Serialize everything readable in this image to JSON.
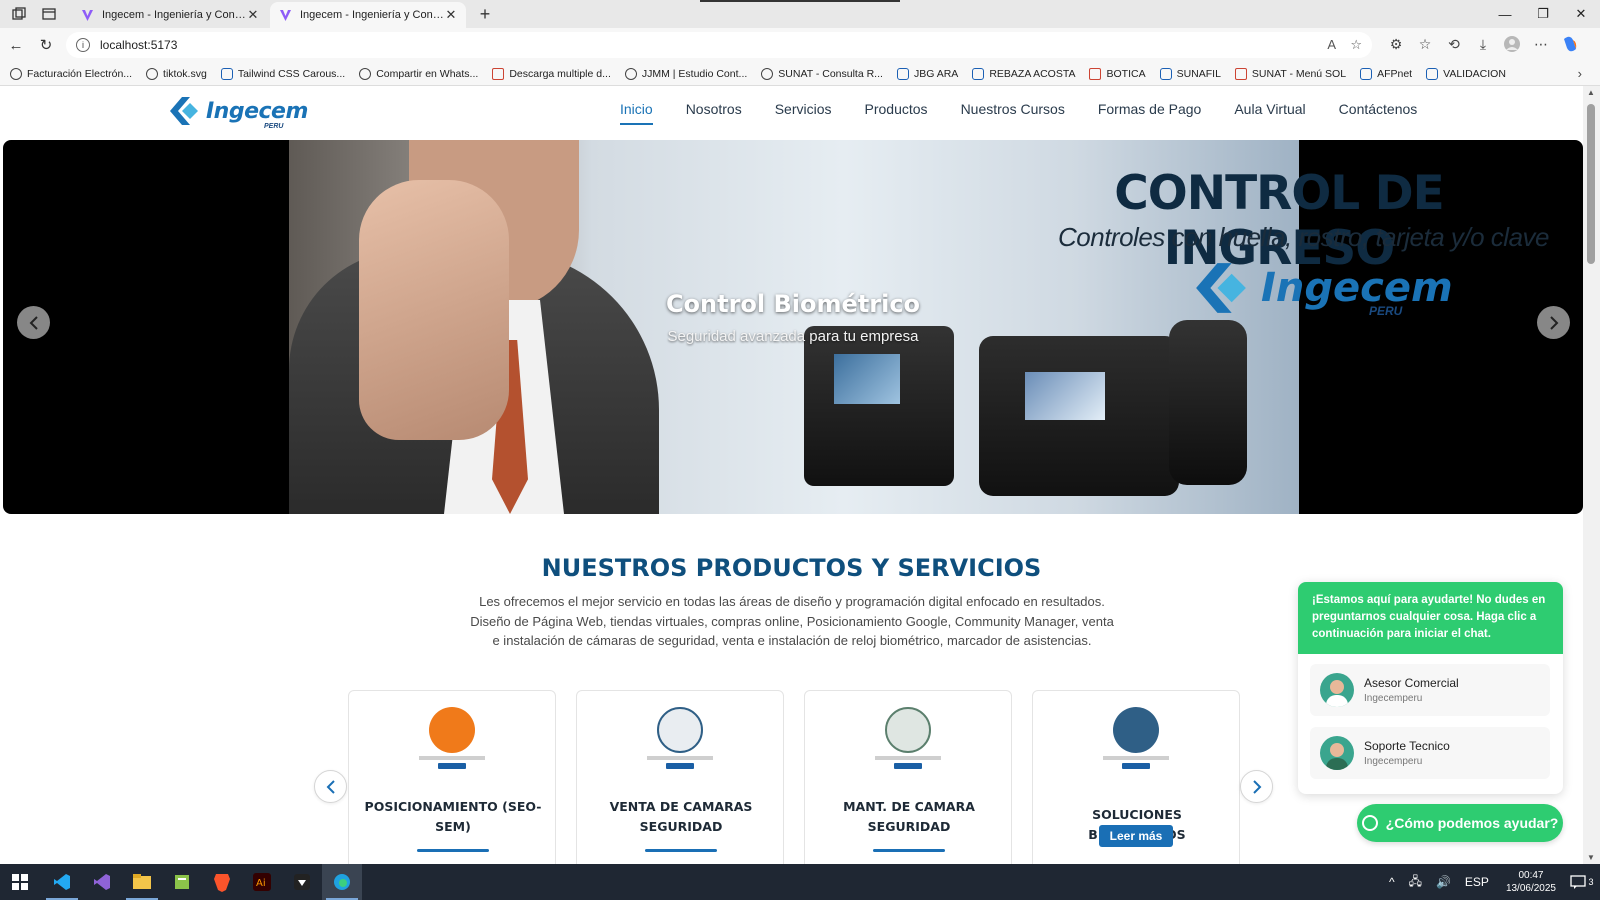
{
  "browser": {
    "tabs": [
      {
        "title": "Ingecem - Ingeniería y Construcci",
        "active": false
      },
      {
        "title": "Ingecem - Ingeniería y Construcci",
        "active": true
      }
    ],
    "url": "localhost:5173",
    "bookmarks": [
      "Facturación Electrón...",
      "tiktok.svg",
      "Tailwind CSS Carous...",
      "Compartir en Whats...",
      "Descarga multiple d...",
      "JJMM | Estudio Cont...",
      "SUNAT - Consulta R...",
      "JBG ARA",
      "REBAZA ACOSTA",
      "BOTICA",
      "SUNAFIL",
      "SUNAT - Menú SOL",
      "AFPnet",
      "VALIDACION"
    ]
  },
  "site": {
    "logo_text": "Ingecem",
    "logo_sub": "PERU",
    "nav": [
      "Inicio",
      "Nosotros",
      "Servicios",
      "Productos",
      "Nuestros Cursos",
      "Formas de Pago",
      "Aula Virtual",
      "Contáctenos"
    ],
    "active_nav": "Inicio"
  },
  "hero": {
    "image_title": "CONTROL DE INGRESO",
    "image_subtitle": "Controles con huella, rostro, tarjeta y/o clave",
    "image_logo": "Ingecem",
    "image_logo_sub": "PERU",
    "caption_title": "Control Biométrico",
    "caption_text": "Seguridad avanzada para tu empresa"
  },
  "services": {
    "title": "NUESTROS PRODUCTOS Y SERVICIOS",
    "description": "Les ofrecemos el mejor servicio en todas las áreas de diseño y programación digital enfocado en resultados. Diseño de Página Web, tiendas virtuales, compras online, Posicionamiento Google, Community Manager, venta e instalación de cámaras de seguridad, venta e instalación de reloj biométrico, marcador de asistencias.",
    "cards": [
      {
        "name": "POSICIONAMIENTO (SEO-SEM)",
        "icon": "seo-icon",
        "color": "#f07a1a"
      },
      {
        "name": "VENTA DE CAMARAS SEGURIDAD",
        "icon": "camera-sale-icon",
        "color": "#e9edf1"
      },
      {
        "name": "MANT. DE CAMARA SEGURIDAD",
        "icon": "camera-maintenance-icon",
        "color": "#dfe6e2"
      },
      {
        "name": "SOLUCIONES BIOMETRICOS",
        "icon": "biometric-icon",
        "color": "#2f5f86"
      }
    ],
    "button_label": "Leer más"
  },
  "chat": {
    "header": "¡Estamos aquí para ayudarte! No dudes en preguntarnos cualquier cosa. Haga clic a continuación para iniciar el chat.",
    "agents": [
      {
        "name": "Asesor Comercial",
        "company": "Ingecemperu"
      },
      {
        "name": "Soporte Tecnico",
        "company": "Ingecemperu"
      }
    ],
    "cta": "¿Cómo podemos ayudar?"
  },
  "taskbar": {
    "language": "ESP",
    "time": "00:47",
    "date": "13/06/2025",
    "notifications": "3"
  },
  "colors": {
    "brand_blue": "#1a73b6",
    "title_blue": "#0f4f7d",
    "whatsapp_green": "#2ecc71"
  }
}
